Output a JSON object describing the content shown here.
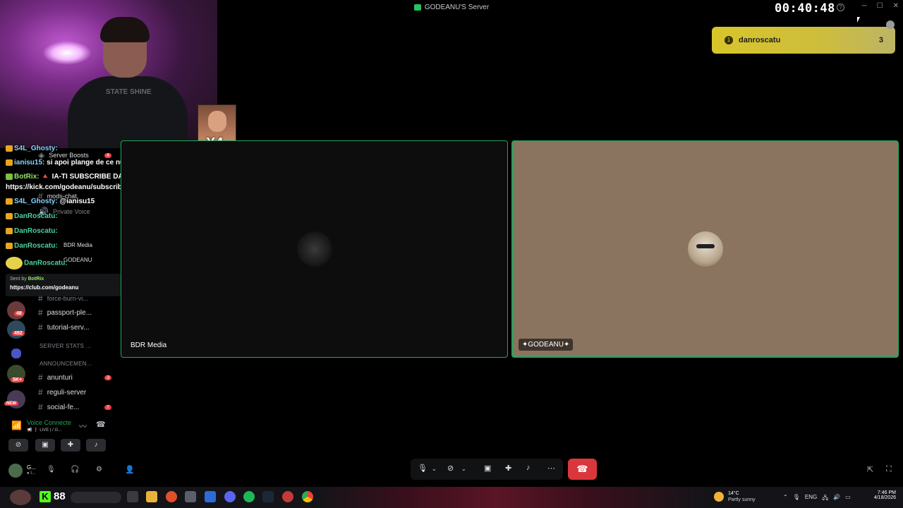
{
  "window": {
    "title": "GODEANU'S Server",
    "timer": "00:40:48",
    "controls": [
      "─",
      "☐",
      "✕"
    ],
    "help_icon": "?"
  },
  "stream": {
    "emote_count": "X4",
    "shirt_text": "STATE SHINE"
  },
  "servers": {
    "badges": [
      "48",
      "492",
      "5K+",
      "NEW"
    ]
  },
  "channels": {
    "items": [
      {
        "label": "Server Boosts",
        "count": "4"
      },
      {
        "label": "mods-chat"
      },
      {
        "label": "Private Voice"
      },
      {
        "label": "BDR Media"
      },
      {
        "label": "GODEANU"
      },
      {
        "label": "force-burn-vi..."
      },
      {
        "label": "passport-ple..."
      },
      {
        "label": "tutorial-serv..."
      }
    ],
    "categories": [
      "SERVER STATS ...",
      "ANNOUNCEMEN..."
    ],
    "bottom": [
      {
        "label": "anunturi",
        "count": "3"
      },
      {
        "label": "reguli-server"
      },
      {
        "label": "social-fe...",
        "count": "7"
      }
    ]
  },
  "chat": {
    "messages": [
      {
        "user": "S4L_Ghosty:",
        "text": ""
      },
      {
        "user": "ianisu15:",
        "text": "si apoi plange de ce nu are progres la sala"
      },
      {
        "user": "BotRix:",
        "text": "🔺 IA-TI SUBSCRIBE DACA ESTI PE TELEFON CU 4.99$ :"
      },
      {
        "user": "",
        "text": "https://kick.com/godeanu/subscribe 🔺"
      },
      {
        "user": "S4L_Ghosty:",
        "text": "@ianisu15"
      },
      {
        "user": "DanRoscatu:",
        "text": ""
      },
      {
        "user": "DanRoscatu:",
        "text": ""
      },
      {
        "user": "DanRoscatu:",
        "text": ""
      },
      {
        "user": "DanRoscatu:",
        "text": ""
      }
    ],
    "sent_by_label": "Sent by",
    "sent_by_bot": "BotRix",
    "sent_by_url": "https://club.com/godeanu"
  },
  "voice": {
    "title": "Voice Connecte",
    "subtitle": "📢 ❗ LIVE | / G..."
  },
  "user": {
    "name": "G...",
    "status": "● I..."
  },
  "tiles": [
    {
      "label": "BDR Media"
    },
    {
      "label": "✦GODEANU✦"
    }
  ],
  "notification": {
    "name": "danroscatu",
    "count": "3",
    "rank": "1"
  },
  "taskbar": {
    "kick_number": "88",
    "weather_temp": "14°C",
    "weather_desc": "Partly sunny",
    "lang": "ENG",
    "time": "7:46 PM",
    "date": "4/18/2026"
  },
  "colors": {
    "accent_green": "#23a55a",
    "hangup_red": "#da373c",
    "notif_yellow": "#d8c52a",
    "kick_green": "#53fc18"
  }
}
